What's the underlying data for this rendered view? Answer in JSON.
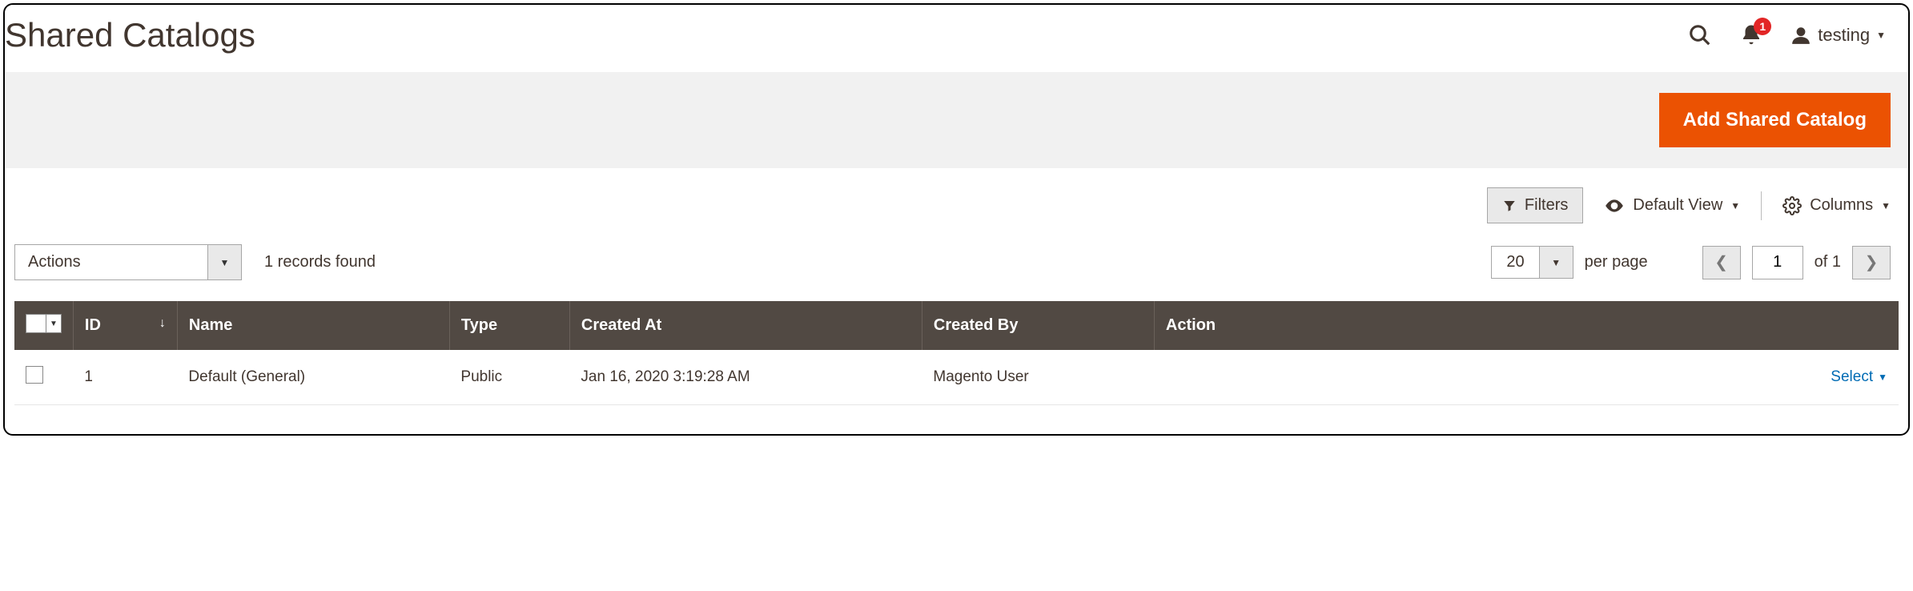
{
  "header": {
    "page_title": "Shared Catalogs",
    "notification_count": "1",
    "user_name": "testing"
  },
  "primary_action": {
    "label": "Add Shared Catalog"
  },
  "toolbar": {
    "filters_label": "Filters",
    "default_view_label": "Default View",
    "columns_label": "Columns"
  },
  "pager": {
    "actions_label": "Actions",
    "records_found": "1 records found",
    "per_page_value": "20",
    "per_page_label": "per page",
    "current_page": "1",
    "of_label": "of 1"
  },
  "table": {
    "columns": {
      "id": "ID",
      "name": "Name",
      "type": "Type",
      "created_at": "Created At",
      "created_by": "Created By",
      "action": "Action"
    },
    "rows": [
      {
        "id": "1",
        "name": "Default (General)",
        "type": "Public",
        "created_at": "Jan 16, 2020 3:19:28 AM",
        "created_by": "Magento User",
        "action_label": "Select"
      }
    ]
  }
}
